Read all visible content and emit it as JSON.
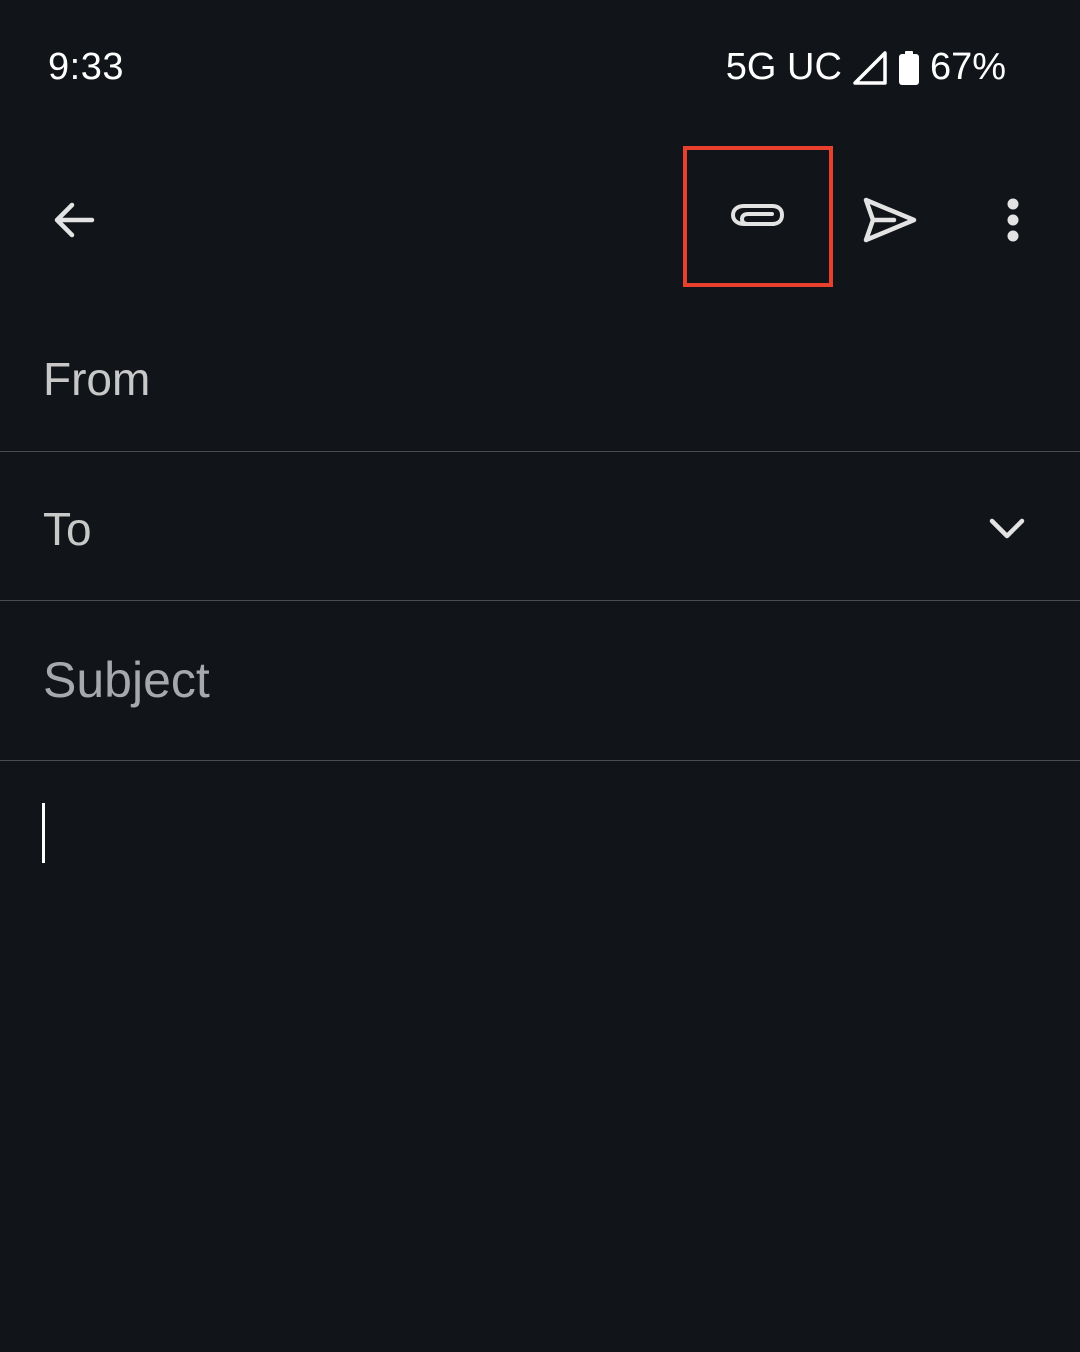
{
  "status_bar": {
    "time": "9:33",
    "network": "5G UC",
    "battery": "67%",
    "icons": [
      "signal-icon",
      "battery-icon"
    ]
  },
  "toolbar": {
    "icons": [
      "back-arrow-icon",
      "paperclip-icon",
      "send-icon",
      "more-vert-icon"
    ],
    "highlight_color": "#e8402c"
  },
  "compose": {
    "from_label": "From",
    "to_label": "To",
    "subject_placeholder": "Subject",
    "body_text": ""
  },
  "colors": {
    "background": "#111418",
    "divider": "#4a4d52",
    "text": "#e3e3e3"
  }
}
